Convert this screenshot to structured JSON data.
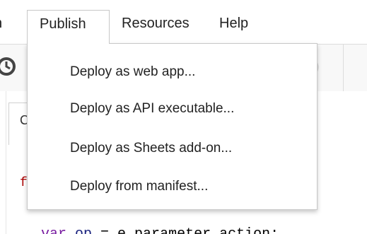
{
  "menubar": {
    "clipped_item": "n",
    "items": [
      {
        "label": "Publish",
        "active": true
      },
      {
        "label": "Resources"
      },
      {
        "label": "Help"
      }
    ]
  },
  "publish_menu": {
    "items": [
      {
        "label": "Deploy as web app..."
      },
      {
        "label": "Deploy as API executable..."
      },
      {
        "label": "Deploy as Sheets add-on..."
      },
      {
        "label": "Deploy from manifest..."
      }
    ]
  },
  "editor": {
    "tab_label": "C",
    "code_peek": "f",
    "code_line_keyword": "var",
    "code_line_name": "op",
    "code_line_rest": " = e.parameter.action;"
  },
  "icons": {
    "toolbar_left": "clock-icon",
    "toolbar_ghost": "debug-icon"
  },
  "colors": {
    "menu_text": "#222222",
    "menu_border": "#c8c8c8",
    "toolbar_bg": "#f8f8f8"
  }
}
